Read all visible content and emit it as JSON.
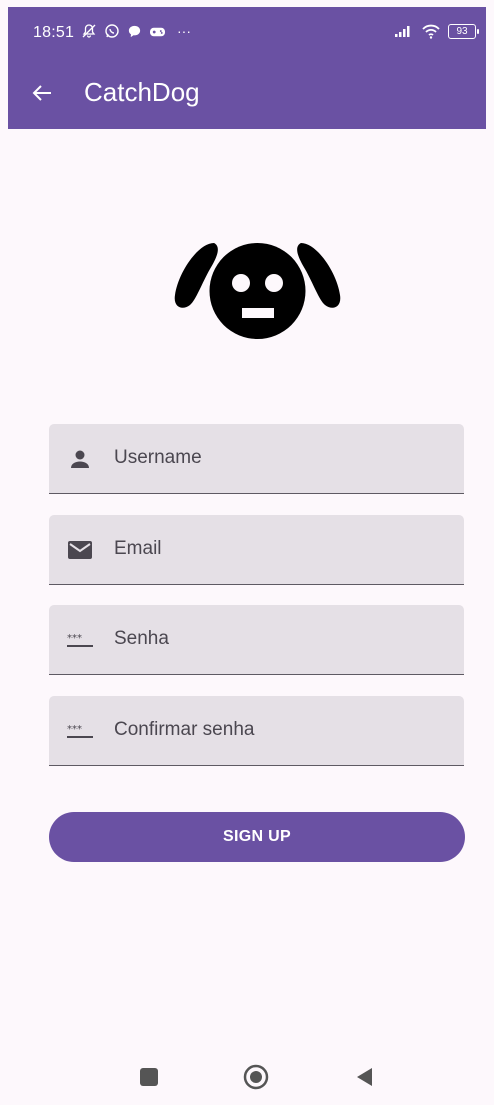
{
  "status_bar": {
    "time": "18:51",
    "notification_icons": [
      "mute-icon",
      "whatsapp-icon",
      "chat-icon",
      "game-icon"
    ],
    "more_indicator": "···",
    "battery_level": "93"
  },
  "app_bar": {
    "title": "CatchDog"
  },
  "form": {
    "username_placeholder": "Username",
    "email_placeholder": "Email",
    "password_placeholder": "Senha",
    "confirm_password_placeholder": "Confirmar senha",
    "signup_label": "SIGN UP"
  },
  "colors": {
    "primary": "#6a51a3",
    "background": "#fdf8fc",
    "field_fill": "#e5e0e6",
    "field_line": "#5e5a63",
    "logo": "#000000"
  }
}
